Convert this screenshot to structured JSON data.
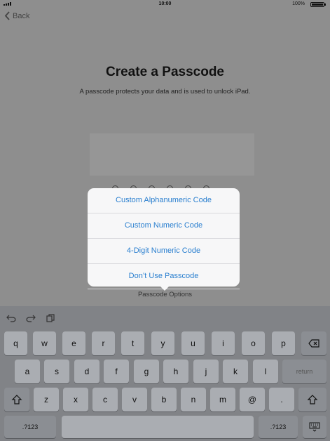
{
  "status_bar": {
    "time": "10:00",
    "battery": "100%"
  },
  "nav": {
    "back_label": "Back"
  },
  "header": {
    "title": "Create a Passcode",
    "subtitle": "A passcode protects your data and is used to unlock iPad."
  },
  "popover": {
    "options": [
      "Custom Alphanumeric Code",
      "Custom Numeric Code",
      "4-Digit Numeric Code",
      "Don’t Use Passcode"
    ],
    "trigger_label": "Passcode Options"
  },
  "keyboard": {
    "row1": [
      "q",
      "w",
      "e",
      "r",
      "t",
      "y",
      "u",
      "i",
      "o",
      "p"
    ],
    "row2": [
      "a",
      "s",
      "d",
      "f",
      "g",
      "h",
      "j",
      "k",
      "l"
    ],
    "row3": [
      "z",
      "x",
      "c",
      "v",
      "b",
      "n",
      "m",
      "@",
      "."
    ],
    "return_label": "return",
    "numbers_label": ".?123"
  },
  "colors": {
    "accent": "#2a7fcf"
  }
}
